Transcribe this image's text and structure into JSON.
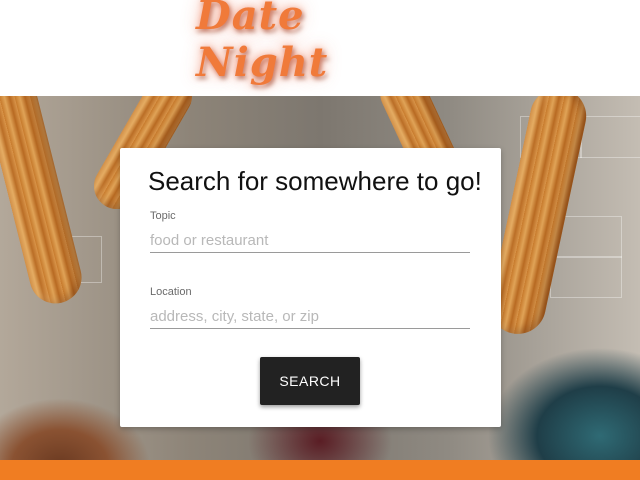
{
  "header": {
    "logo_text": "Date Night",
    "logo_color": "#f07a3a"
  },
  "search_card": {
    "title": "Search for somewhere to go!",
    "topic": {
      "label": "Topic",
      "placeholder": "food or restaurant",
      "value": ""
    },
    "location": {
      "label": "Location",
      "placeholder": "address, city, state, or zip",
      "value": ""
    },
    "search_button_label": "SEARCH"
  },
  "colors": {
    "accent": "#f07d22",
    "button": "#222222"
  }
}
